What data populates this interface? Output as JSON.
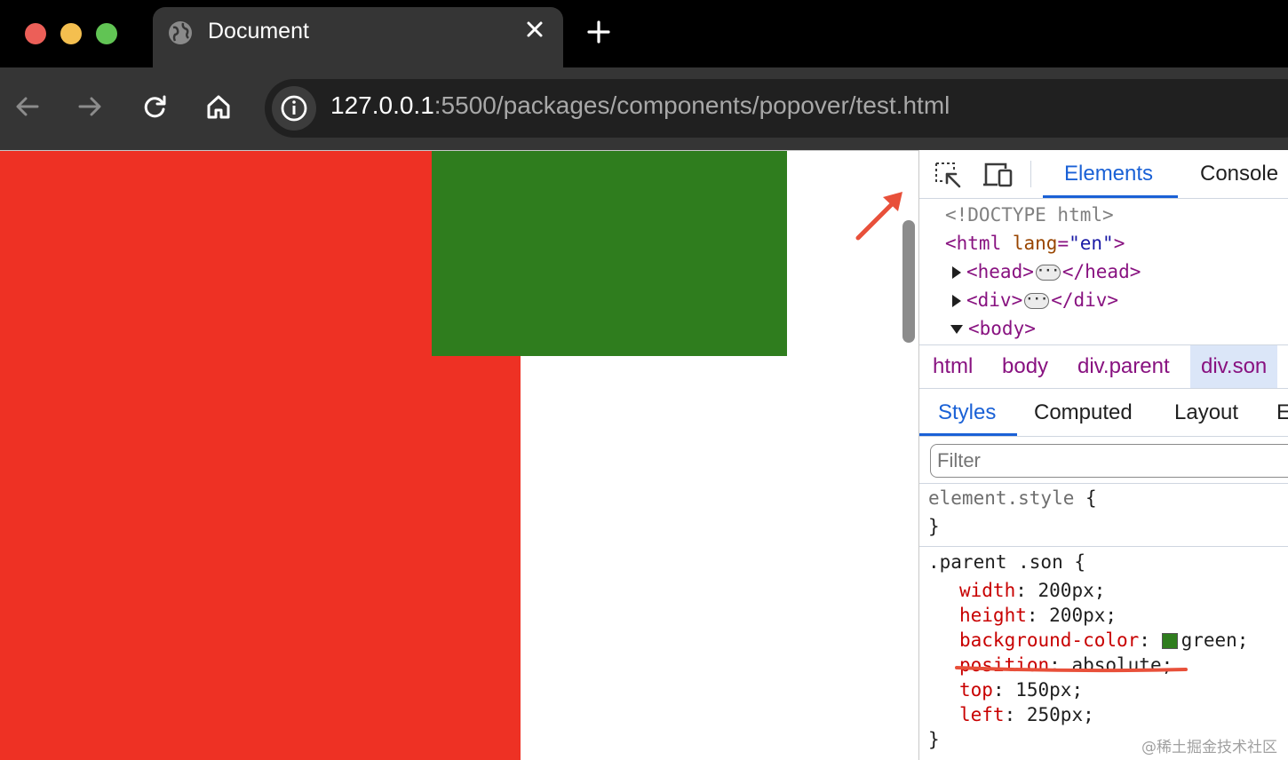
{
  "browser": {
    "tab_title": "Document",
    "url_host": "127.0.0.1",
    "url_rest": ":5500/packages/components/popover/test.html"
  },
  "page": {
    "parent_color": "#ee3124",
    "son_color": "#2f7d1e"
  },
  "devtools": {
    "tabs": [
      "Elements",
      "Console"
    ],
    "dom": {
      "doctype": "<!DOCTYPE html>",
      "html_open": "<html",
      "html_attr_name": "lang",
      "html_attr_value": "\"en\"",
      "head_open": "<head>",
      "head_close": "</head>",
      "div_open": "<div>",
      "div_close": "</div>",
      "body_open": "<body>"
    },
    "breadcrumbs": [
      "html",
      "body",
      "div.parent",
      "div.son"
    ],
    "sub_tabs": [
      "Styles",
      "Computed",
      "Layout",
      "E"
    ],
    "filter_placeholder": "Filter",
    "element_style": {
      "selector": "element.style",
      "open": "{",
      "close": "}"
    },
    "son_rule": {
      "selector": ".parent .son {",
      "close": "}",
      "props": [
        {
          "name": "width",
          "value": "200px;"
        },
        {
          "name": "height",
          "value": "200px;"
        },
        {
          "name": "background-color",
          "value": "green;"
        },
        {
          "name": "position",
          "value": "absolute;"
        },
        {
          "name": "top",
          "value": "150px;"
        },
        {
          "name": "left",
          "value": "250px;"
        }
      ]
    }
  },
  "watermark": "@稀土掘金技术社区"
}
